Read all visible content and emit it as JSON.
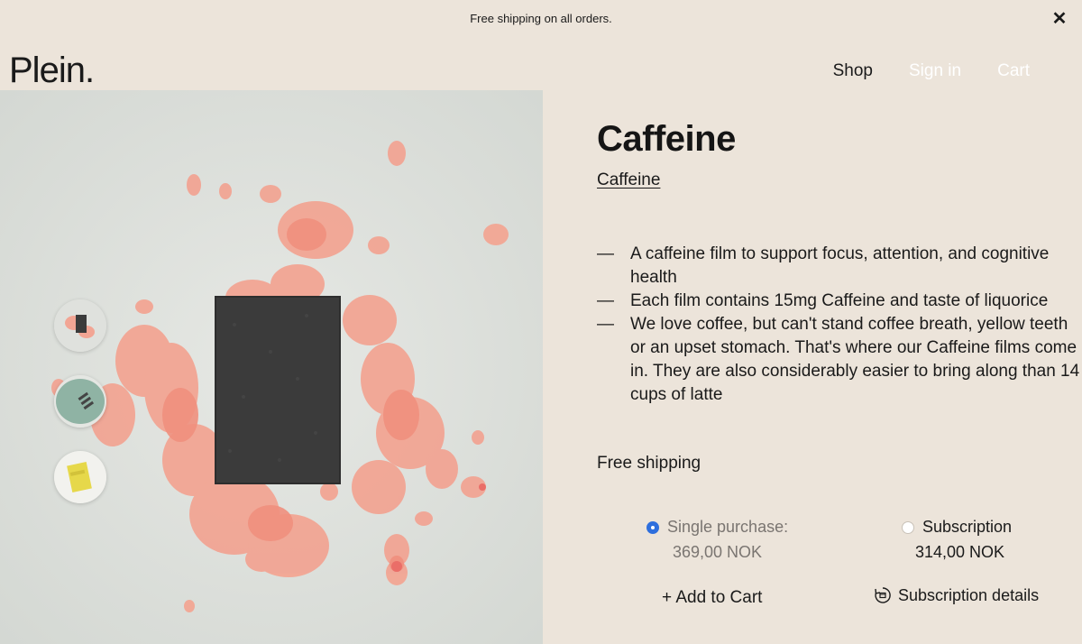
{
  "announcement": {
    "text": "Free shipping on all orders.",
    "close_icon": "close-icon"
  },
  "header": {
    "logo": "Plein.",
    "nav": {
      "shop": "Shop",
      "sign_in": "Sign in",
      "cart": "Cart"
    }
  },
  "product": {
    "title": "Caffeine",
    "subtitle_link": "Caffeine",
    "bullet_marker": "—",
    "bullets": [
      "A caffeine film to support focus, attention, and cognitive health",
      "Each film contains 15mg Caffeine and taste of liquorice",
      "We love coffee, but can't stand coffee breath, yellow teeth or an upset stomach. That's where our Caffeine films come in. They are also considerably easier to bring along than 14 cups of latte"
    ],
    "shipping": "Free shipping"
  },
  "purchase": {
    "single_label": "Single purchase:",
    "single_price": "369,00 NOK",
    "single_selected": true,
    "subscription_label": "Subscription",
    "subscription_price": "314,00 NOK",
    "add_to_cart": "+ Add to Cart",
    "subscription_details": "Subscription details",
    "subscription_icon": "subscription-refresh-icon"
  },
  "gallery": {
    "thumbnails": [
      "caffeine-film-thumbnail",
      "film-case-thumbnail",
      "yellow-pouch-thumbnail"
    ]
  },
  "colors": {
    "background": "#ece4da",
    "accent": "#2f6fdd",
    "muted_text": "#7a7571"
  }
}
